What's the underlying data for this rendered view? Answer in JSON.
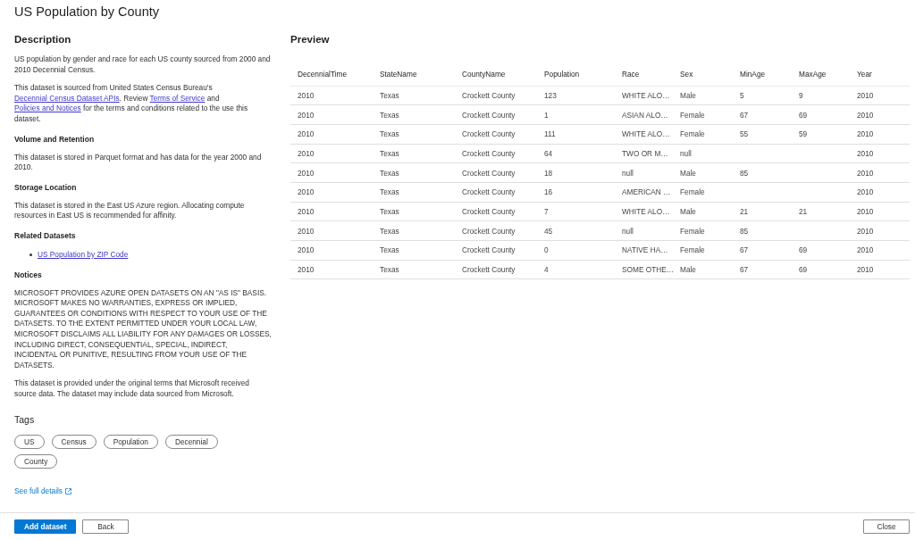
{
  "window": {
    "title": "US Population by County"
  },
  "details": {
    "heading": "Description",
    "paragraphs": [
      [
        {
          "kind": "text",
          "text": "US population by gender and race for each US county sourced from 2000 and 2010 Decennial Census."
        }
      ],
      [
        {
          "kind": "text",
          "text": "This dataset is sourced from United States Census Bureau's "
        },
        {
          "kind": "link",
          "text": "Decennial Census Dataset APIs"
        },
        {
          "kind": "text",
          "text": ". Review "
        },
        {
          "kind": "link",
          "text": "Terms of Service"
        },
        {
          "kind": "text",
          "text": " and "
        },
        {
          "kind": "link",
          "text": "Policies and Notices"
        },
        {
          "kind": "text",
          "text": " for the terms and conditions related to the use this dataset."
        }
      ]
    ],
    "sections": [
      {
        "title": "Volume and Retention",
        "paragraphs": [
          [
            {
              "kind": "text",
              "text": "This dataset is stored in Parquet format and has data for the year 2000 and 2010."
            }
          ]
        ]
      },
      {
        "title": "Storage Location",
        "paragraphs": [
          [
            {
              "kind": "text",
              "text": "This dataset is stored in the East US Azure region. Allocating compute resources in East US is recommended for affinity."
            }
          ]
        ]
      },
      {
        "title": "Related Datasets",
        "links": [
          "US Population by ZIP Code"
        ]
      },
      {
        "title": "Notices",
        "paragraphs": [
          [
            {
              "kind": "text",
              "text": "MICROSOFT PROVIDES AZURE OPEN DATASETS ON AN \"AS IS\" BASIS. MICROSOFT MAKES NO WARRANTIES, EXPRESS OR IMPLIED, GUARANTEES OR CONDITIONS WITH RESPECT TO YOUR USE OF THE DATASETS. TO THE EXTENT PERMITTED UNDER YOUR LOCAL LAW, MICROSOFT DISCLAIMS ALL LIABILITY FOR ANY DAMAGES OR LOSSES, INCLUDING DIRECT, CONSEQUENTIAL, SPECIAL, INDIRECT, INCIDENTAL OR PUNITIVE, RESULTING FROM YOUR USE OF THE DATASETS."
            }
          ],
          [
            {
              "kind": "text",
              "text": "This dataset is provided under the original terms that Microsoft received source data. The dataset may include data sourced from Microsoft."
            }
          ]
        ]
      }
    ],
    "tags_heading": "Tags",
    "tags": [
      "US",
      "Census",
      "Population",
      "Decennial",
      "County"
    ],
    "details_link": "See full details"
  },
  "preview": {
    "heading": "Preview",
    "table": {
      "columns": [
        "DecennialTime",
        "StateName",
        "CountyName",
        "Population",
        "Race",
        "Sex",
        "MinAge",
        "MaxAge",
        "Year"
      ],
      "rows": [
        {
          "decennial_time": "2010",
          "state_name": "Texas",
          "county_name": "Crockett County",
          "population": "123",
          "race": "WHITE ALO…",
          "sex": "Male",
          "min_age": "5",
          "max_age": "9",
          "year": "2010"
        },
        {
          "decennial_time": "2010",
          "state_name": "Texas",
          "county_name": "Crockett County",
          "population": "1",
          "race": "ASIAN ALO…",
          "sex": "Female",
          "min_age": "67",
          "max_age": "69",
          "year": "2010"
        },
        {
          "decennial_time": "2010",
          "state_name": "Texas",
          "county_name": "Crockett County",
          "population": "111",
          "race": "WHITE ALO…",
          "sex": "Female",
          "min_age": "55",
          "max_age": "59",
          "year": "2010"
        },
        {
          "decennial_time": "2010",
          "state_name": "Texas",
          "county_name": "Crockett County",
          "population": "64",
          "race": "TWO OR M…",
          "sex": "null",
          "year": "2010"
        },
        {
          "decennial_time": "2010",
          "state_name": "Texas",
          "county_name": "Crockett County",
          "population": "18",
          "race": "null",
          "sex": "Male",
          "min_age": "85",
          "year": "2010"
        },
        {
          "decennial_time": "2010",
          "state_name": "Texas",
          "county_name": "Crockett County",
          "population": "16",
          "race": "AMERICAN …",
          "sex": "Female",
          "year": "2010"
        },
        {
          "decennial_time": "2010",
          "state_name": "Texas",
          "county_name": "Crockett County",
          "population": "7",
          "race": "WHITE ALO…",
          "sex": "Male",
          "min_age": "21",
          "max_age": "21",
          "year": "2010"
        },
        {
          "decennial_time": "2010",
          "state_name": "Texas",
          "county_name": "Crockett County",
          "population": "45",
          "race": "null",
          "sex": "Female",
          "min_age": "85",
          "year": "2010"
        },
        {
          "decennial_time": "2010",
          "state_name": "Texas",
          "county_name": "Crockett County",
          "population": "0",
          "race": "NATIVE HA…",
          "sex": "Female",
          "min_age": "67",
          "max_age": "69",
          "year": "2010"
        },
        {
          "decennial_time": "2010",
          "state_name": "Texas",
          "county_name": "Crockett County",
          "population": "4",
          "race": "SOME OTHE…",
          "sex": "Male",
          "min_age": "67",
          "max_age": "69",
          "year": "2010"
        }
      ]
    }
  },
  "footer": {
    "buttons": [
      {
        "label": "Add dataset",
        "kind": "primary"
      },
      {
        "label": "Back",
        "kind": "default"
      }
    ],
    "close_button": "Close"
  }
}
